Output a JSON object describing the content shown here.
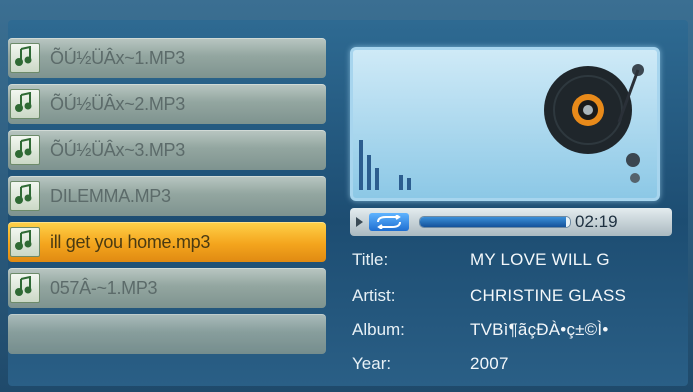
{
  "playlist": {
    "items": [
      {
        "label": "ÕÚ½ÜÂx~1.MP3",
        "selected": false
      },
      {
        "label": "ÕÚ½ÜÂx~2.MP3",
        "selected": false
      },
      {
        "label": "ÕÚ½ÜÂx~3.MP3",
        "selected": false
      },
      {
        "label": "DILEMMA.MP3",
        "selected": false
      },
      {
        "label": "ill get you home.mp3",
        "selected": true
      },
      {
        "label": "057Â-~1.MP3",
        "selected": false
      },
      {
        "label": "",
        "selected": false
      }
    ]
  },
  "player": {
    "time": "02:19",
    "progress": 0.97,
    "play_icon": "play-icon",
    "repeat_icon": "repeat-icon"
  },
  "track": {
    "title_label": "Title:",
    "title_value": "MY LOVE WILL G",
    "artist_label": "Artist:",
    "artist_value": "CHRISTINE GLASS",
    "album_label": "Album:",
    "album_value": "TVBì¶ãçÐÀ•ç±©Ì•",
    "year_label": "Year:",
    "year_value": "2007"
  },
  "colors": {
    "selected_row": "#f4a51d",
    "row": "#93a6a0",
    "background": "#1f4a6b"
  }
}
